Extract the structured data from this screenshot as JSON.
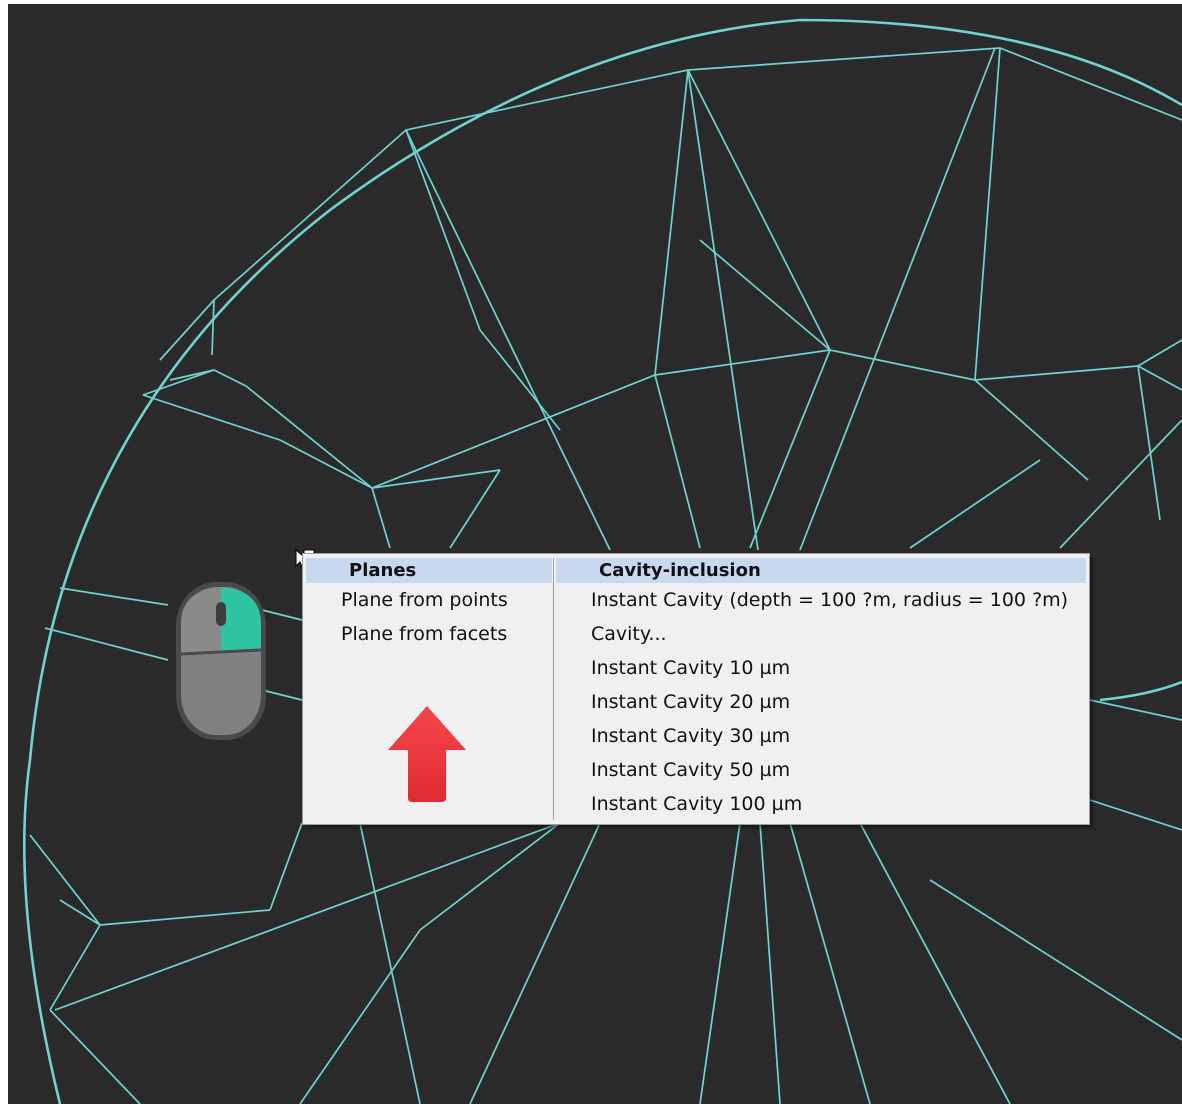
{
  "context_menu": {
    "planes": {
      "header": "Planes",
      "items": [
        "Plane from points",
        "Plane from facets"
      ]
    },
    "cavity_inclusion": {
      "header": "Cavity-inclusion",
      "items": [
        "Instant Cavity (depth = 100 ?m, radius = 100 ?m)",
        "Cavity...",
        "Instant Cavity 10 µm",
        "Instant Cavity 20 µm",
        "Instant Cavity 30 µm",
        "Instant Cavity 50 µm",
        "Instant Cavity 100 µm"
      ]
    }
  },
  "colors": {
    "viewport_background": "#2b2a2b",
    "mesh_lines": "#6fd3d0",
    "menu_background": "#f0f0f0",
    "menu_header_highlight": "#c8d8ee",
    "arrow": "#f0393f",
    "mouse_right_button": "#2ec4a2"
  },
  "icons": {
    "mouse_hint": "mouse-right-click-icon",
    "pointer": "cursor-icon",
    "arrow": "arrow-up-icon"
  }
}
